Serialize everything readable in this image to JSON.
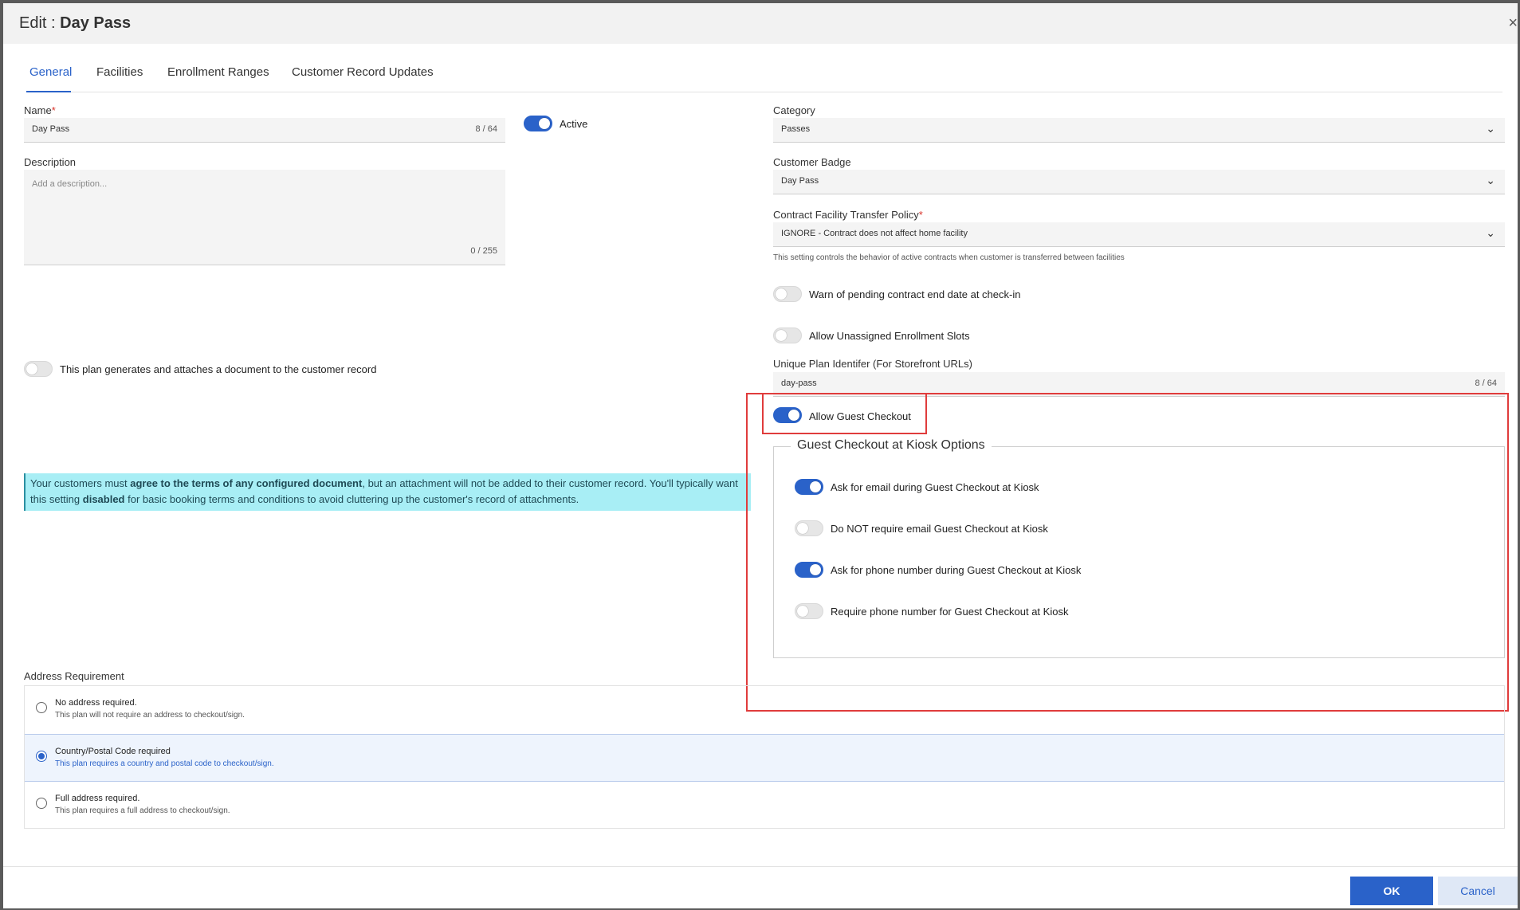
{
  "header": {
    "title_prefix": "Edit : ",
    "title_name": "Day Pass",
    "close": "×"
  },
  "tabs": [
    {
      "label": "General",
      "active": true
    },
    {
      "label": "Facilities"
    },
    {
      "label": "Enrollment Ranges"
    },
    {
      "label": "Customer Record Updates"
    }
  ],
  "form": {
    "name_label": "Name",
    "required_mark": "*",
    "name_value": "Day Pass",
    "name_count": "8 / 64",
    "active_label": "Active",
    "description_label": "Description",
    "description_placeholder": "Add a description...",
    "description_count": "0 / 255",
    "document_toggle_label": "This plan generates and attaches a document to the customer record",
    "info_part1": "Your customers must ",
    "info_bold1": "agree to the terms of any configured document",
    "info_part2": ", but an attachment will not be added to their customer record. You'll typically want this setting ",
    "info_bold2": "disabled",
    "info_part3": " for basic booking terms and conditions to avoid cluttering up the customer's record of attachments.",
    "category_label": "Category",
    "category_value": "Passes",
    "badge_label": "Customer Badge",
    "badge_value": "Day Pass",
    "transfer_label": "Contract Facility Transfer Policy",
    "transfer_value": "IGNORE - Contract does not affect home facility",
    "transfer_hint": "This setting controls the behavior of active contracts when customer is transferred between facilities",
    "warn_label": "Warn of pending contract end date at check-in",
    "unassigned_label": "Allow Unassigned Enrollment Slots",
    "identifier_label": "Unique Plan Identifer (For Storefront URLs)",
    "identifier_value": "day-pass",
    "identifier_count": "8 / 64",
    "guest_checkout_label": "Allow Guest Checkout",
    "kiosk_legend": "Guest Checkout at Kiosk Options",
    "kiosk_options": [
      {
        "label": "Ask for email during Guest Checkout at Kiosk",
        "on": true
      },
      {
        "label": "Do NOT require email Guest Checkout at Kiosk",
        "on": false
      },
      {
        "label": "Ask for phone number during Guest Checkout at Kiosk",
        "on": true
      },
      {
        "label": "Require phone number for Guest Checkout at Kiosk",
        "on": false
      }
    ]
  },
  "address": {
    "label": "Address Requirement",
    "options": [
      {
        "title": "No address required.",
        "desc": "This plan will not require an address to checkout/sign.",
        "selected": false
      },
      {
        "title": "Country/Postal Code required",
        "desc": "This plan requires a country and postal code to checkout/sign.",
        "selected": true
      },
      {
        "title": "Full address required.",
        "desc": "This plan requires a full address to checkout/sign.",
        "selected": false
      }
    ]
  },
  "footer": {
    "ok": "OK",
    "cancel": "Cancel"
  },
  "icons": {
    "dropdown": "chevron-down-icon"
  },
  "colors": {
    "accent": "#2a62c9",
    "highlight": "#e03c3c",
    "info_bg": "#a8eef5"
  }
}
